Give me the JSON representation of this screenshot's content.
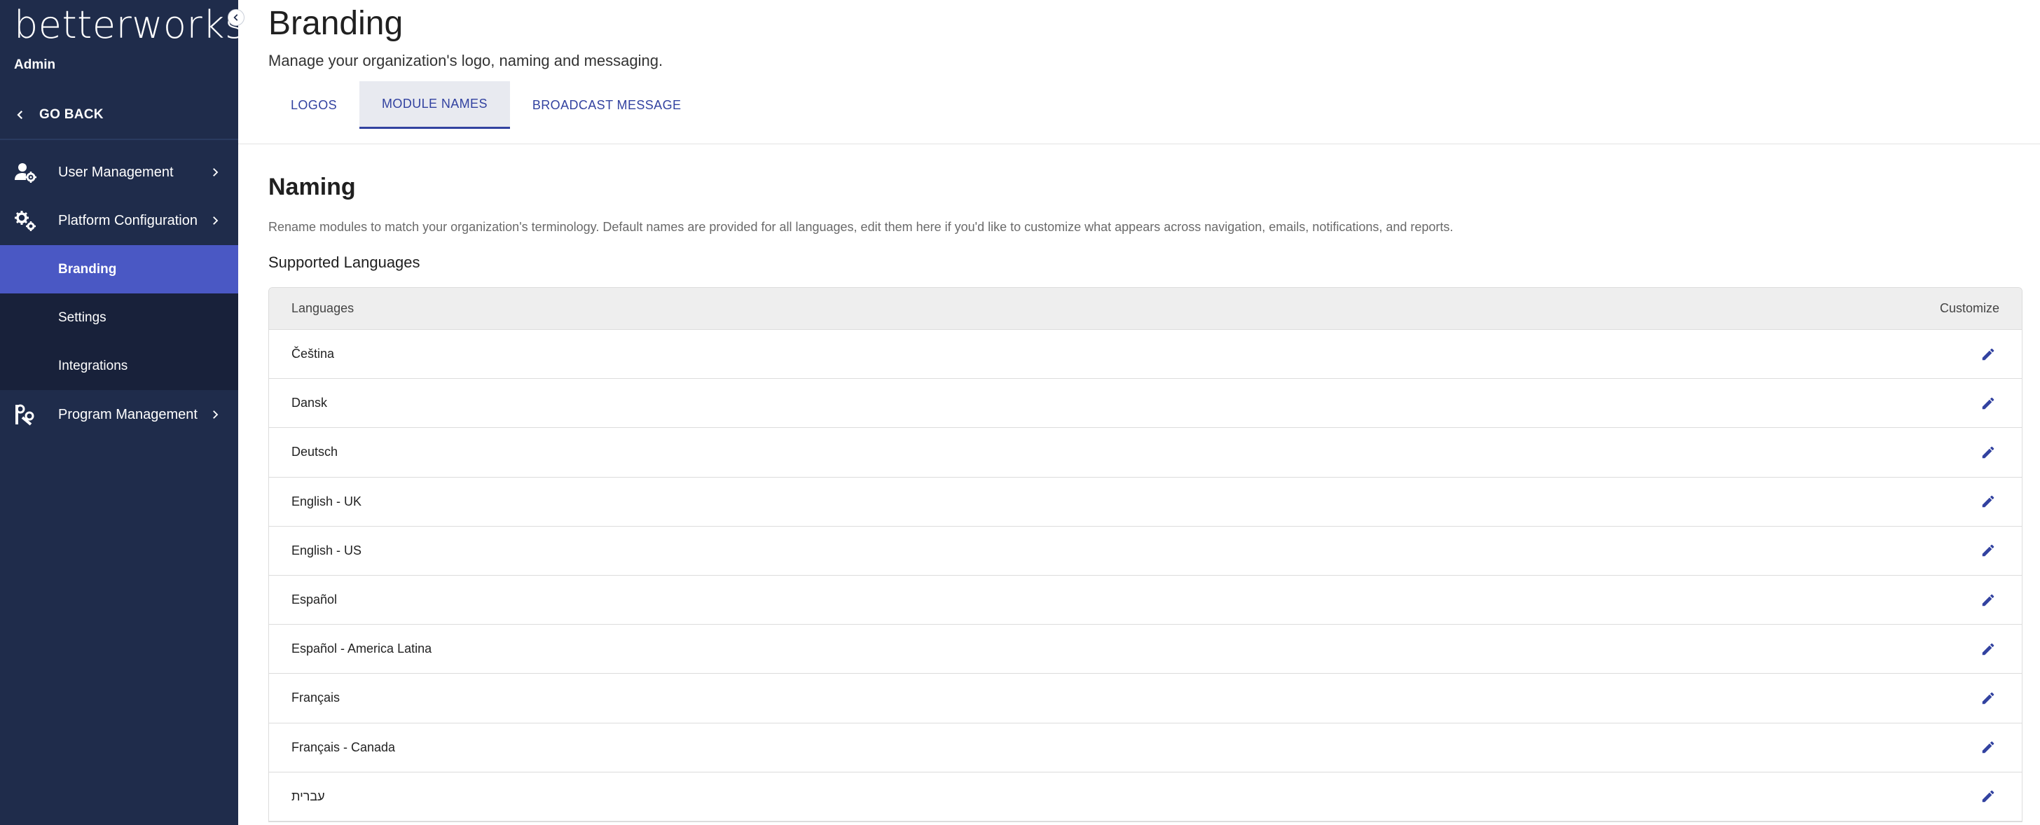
{
  "sidebar": {
    "logo_text": "betterworks",
    "role_label": "Admin",
    "go_back_label": "GO BACK",
    "items": [
      {
        "label": "User Management",
        "icon": "user-gear-icon"
      },
      {
        "label": "Platform Configuration",
        "icon": "gears-icon"
      },
      {
        "label": "Branding",
        "active": true
      },
      {
        "label": "Settings"
      },
      {
        "label": "Integrations"
      },
      {
        "label": "Program Management",
        "icon": "tools-icon"
      }
    ]
  },
  "header": {
    "title": "Branding",
    "subtitle": "Manage your organization's logo, naming and messaging."
  },
  "tabs": [
    {
      "label": "LOGOS"
    },
    {
      "label": "MODULE NAMES",
      "active": true
    },
    {
      "label": "BROADCAST MESSAGE"
    }
  ],
  "naming": {
    "title": "Naming",
    "description": "Rename modules to match your organization's terminology. Default names are provided for all languages, edit them here if you'd like to customize what appears across navigation, emails, notifications, and reports.",
    "supported_title": "Supported Languages"
  },
  "table": {
    "columns": [
      "Languages",
      "Customize"
    ],
    "rows": [
      "Čeština",
      "Dansk",
      "Deutsch",
      "English - UK",
      "English - US",
      "Español",
      "Español - America Latina",
      "Français",
      "Français - Canada",
      "עברית"
    ]
  },
  "colors": {
    "sidebar_bg": "#1f2c4b",
    "sidebar_sub_bg": "#18213a",
    "active_item": "#4a58c4",
    "accent": "#3242a0"
  }
}
